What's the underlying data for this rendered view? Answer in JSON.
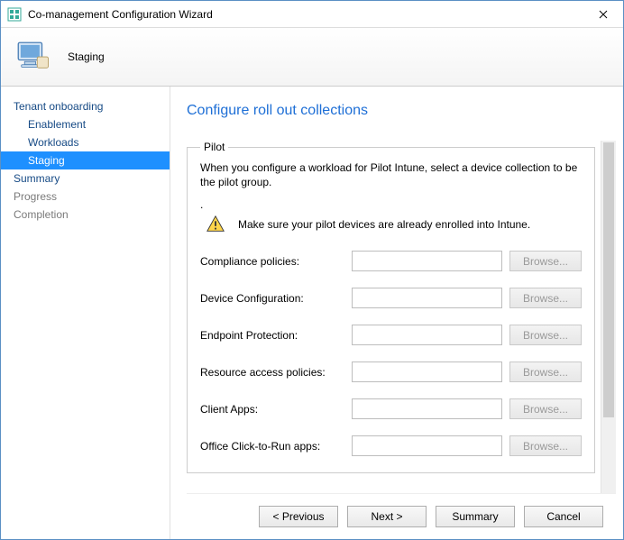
{
  "window": {
    "title": "Co-management Configuration Wizard"
  },
  "header": {
    "stage": "Staging"
  },
  "sidebar": {
    "items": [
      {
        "label": "Tenant onboarding",
        "sub": false,
        "selected": false,
        "muted": false
      },
      {
        "label": "Enablement",
        "sub": true,
        "selected": false,
        "muted": false
      },
      {
        "label": "Workloads",
        "sub": true,
        "selected": false,
        "muted": false
      },
      {
        "label": "Staging",
        "sub": true,
        "selected": true,
        "muted": false
      },
      {
        "label": "Summary",
        "sub": false,
        "selected": false,
        "muted": false
      },
      {
        "label": "Progress",
        "sub": false,
        "selected": false,
        "muted": true
      },
      {
        "label": "Completion",
        "sub": false,
        "selected": false,
        "muted": true
      }
    ]
  },
  "main": {
    "title": "Configure roll out collections",
    "group_legend": "Pilot",
    "description": "When you configure a workload for Pilot Intune, select a device collection to be the pilot group.",
    "warning": "Make sure your pilot devices are already enrolled into Intune.",
    "browse_label": "Browse...",
    "rows": [
      {
        "label": "Compliance policies:",
        "value": ""
      },
      {
        "label": "Device Configuration:",
        "value": ""
      },
      {
        "label": "Endpoint Protection:",
        "value": ""
      },
      {
        "label": "Resource access policies:",
        "value": ""
      },
      {
        "label": "Client Apps:",
        "value": ""
      },
      {
        "label": "Office Click-to-Run apps:",
        "value": ""
      }
    ]
  },
  "footer": {
    "previous": "< Previous",
    "next": "Next >",
    "summary": "Summary",
    "cancel": "Cancel"
  }
}
